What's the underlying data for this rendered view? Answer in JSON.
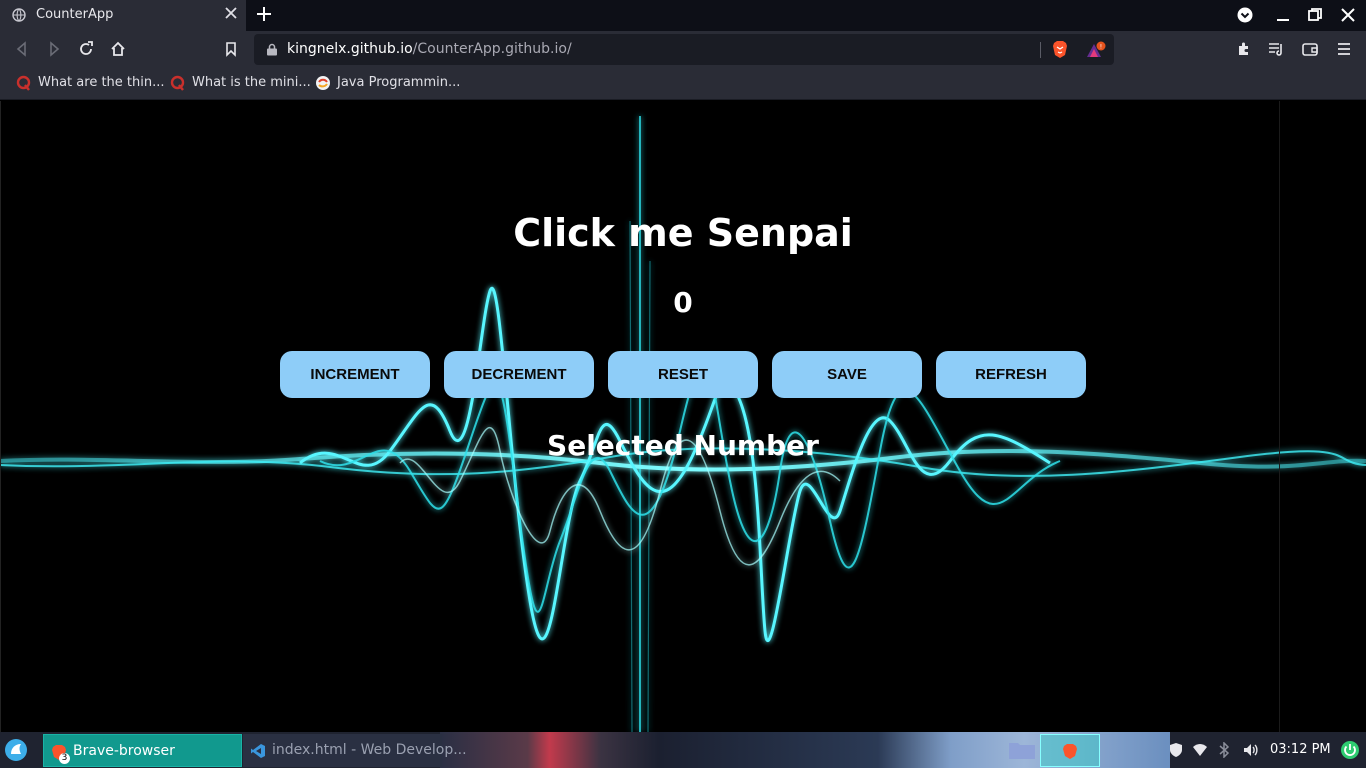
{
  "browser": {
    "tab_title": "CounterApp",
    "url_host": "kingnelx.github.io",
    "url_path": "/CounterApp.github.io/",
    "bookmarks": [
      {
        "label": "What are the thin...",
        "icon": "quora-icon"
      },
      {
        "label": "What is the mini...",
        "icon": "quora-icon"
      },
      {
        "label": "Java Programmin...",
        "icon": "site-icon"
      }
    ]
  },
  "page": {
    "heading": "Click me Senpai",
    "count": "0",
    "buttons": {
      "increment": "INCREMENT",
      "decrement": "DECREMENT",
      "reset": "RESET",
      "save": "SAVE",
      "refresh": "REFRESH"
    },
    "selected_label": "Selected Number"
  },
  "taskbar": {
    "tasks": [
      {
        "label": "Brave-browser",
        "badge": "3"
      },
      {
        "label": "index.html - Web Develop..."
      }
    ],
    "clock": "03:12 PM"
  },
  "colors": {
    "button_bg": "#8ecdf8",
    "wave": "#4ff7ff",
    "active_task": "#11998e"
  }
}
